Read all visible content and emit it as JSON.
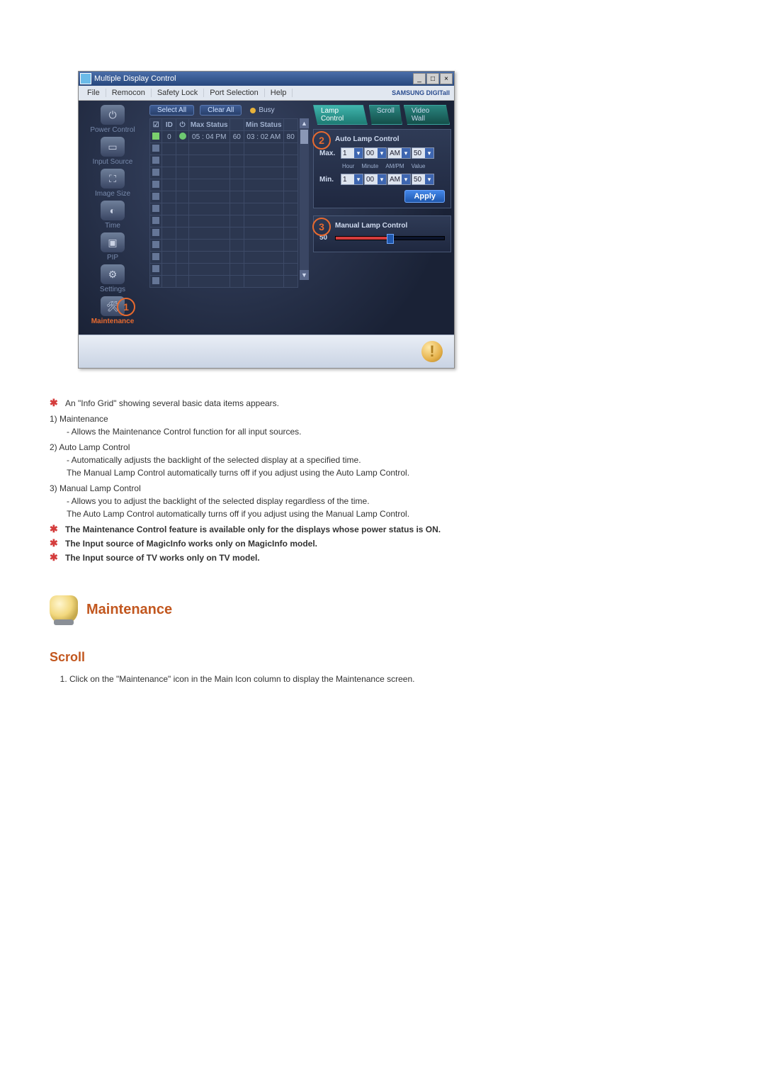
{
  "window": {
    "title": "Multiple Display Control",
    "brand": "SAMSUNG DIGITall"
  },
  "menubar": [
    "File",
    "Remocon",
    "Safety Lock",
    "Port Selection",
    "Help"
  ],
  "sidebar": [
    {
      "label": "Power Control"
    },
    {
      "label": "Input Source"
    },
    {
      "label": "Image Size"
    },
    {
      "label": "Time"
    },
    {
      "label": "PIP"
    },
    {
      "label": "Settings"
    },
    {
      "label": "Maintenance"
    }
  ],
  "actions": {
    "select_all": "Select All",
    "clear_all": "Clear All",
    "busy": "Busy"
  },
  "grid": {
    "headers": {
      "chk": "☑",
      "id": "ID",
      "pwr": "⏻",
      "max": "Max Status",
      "maxv": "",
      "min": "Min Status",
      "minv": ""
    },
    "row0": {
      "id": "0",
      "max": "05 : 04 PM",
      "maxv": "60",
      "min": "03 : 02 AM",
      "minv": "80"
    }
  },
  "tabs": {
    "lamp": "Lamp Control",
    "scroll": "Scroll",
    "video": "Video Wall"
  },
  "auto_lamp": {
    "title": "Auto Lamp Control",
    "max_label": "Max.",
    "min_label": "Min.",
    "col_hour": "Hour",
    "col_minute": "Minute",
    "col_ampm": "AM/PM",
    "col_value": "Value",
    "max": {
      "hour": "1",
      "minute": "00",
      "ampm": "AM",
      "value": "50"
    },
    "min": {
      "hour": "1",
      "minute": "00",
      "ampm": "AM",
      "value": "50"
    },
    "apply": "Apply"
  },
  "manual_lamp": {
    "title": "Manual Lamp Control",
    "value": "50"
  },
  "callouts": {
    "c1": "1",
    "c2": "2",
    "c3": "3"
  },
  "doc": {
    "star1": "An \"Info Grid\" showing several basic data items appears.",
    "n1_head": "1)  Maintenance",
    "n1_sub": "- Allows the Maintenance Control function for all input sources.",
    "n2_head": "2)  Auto Lamp Control",
    "n2_sub1": "- Automatically adjusts the backlight of the selected display at a specified time.",
    "n2_sub2": "The Manual Lamp Control automatically turns off if you adjust using the Auto Lamp Control.",
    "n3_head": "3)  Manual Lamp Control",
    "n3_sub1": "- Allows you to adjust the backlight of the selected display regardless of the time.",
    "n3_sub2": "The Auto Lamp Control automatically turns off if you adjust using the Manual Lamp Control.",
    "note1": "The Maintenance Control feature is available only for the displays whose power status is ON.",
    "note2": "The Input source of MagicInfo works only on MagicInfo model.",
    "note3": "The Input source of TV works only on TV model.",
    "section_title": "Maintenance",
    "subhead": "Scroll",
    "step1": "Click on the \"Maintenance\" icon in the Main Icon column to display the Maintenance screen."
  }
}
